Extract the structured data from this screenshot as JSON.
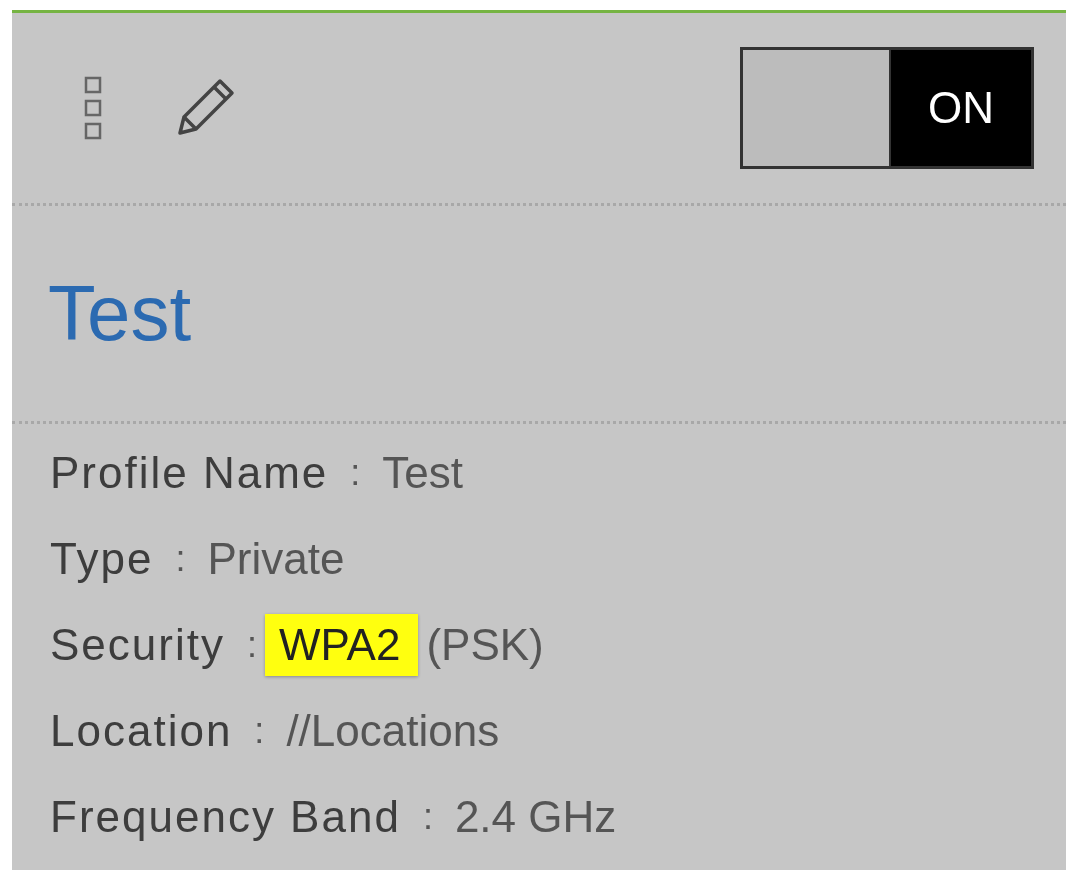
{
  "toggle": {
    "label": "ON",
    "on": true
  },
  "title": "Test",
  "details": [
    {
      "label": "Profile Name",
      "separator": ":",
      "value": "Test"
    },
    {
      "label": "Type",
      "separator": ":",
      "value": "Private"
    },
    {
      "label": "Security",
      "separator": ":",
      "highlight": "WPA2",
      "value": "(PSK)"
    },
    {
      "label": "Location",
      "separator": ":",
      "value": "//Locations"
    },
    {
      "label": "Frequency Band",
      "separator": ":",
      "value": "2.4 GHz"
    }
  ]
}
